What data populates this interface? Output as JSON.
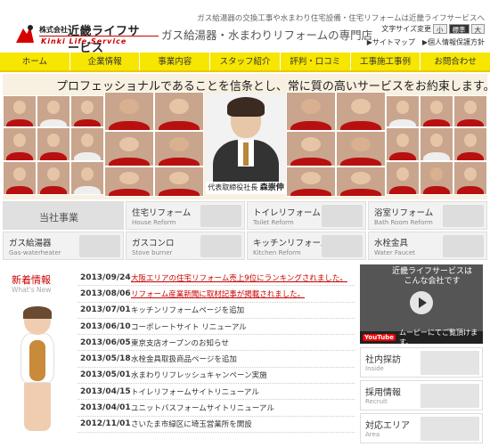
{
  "header": {
    "logo_corp": "株式会社",
    "logo_name": "近畿ライフサービス",
    "logo_en": "Kinki Life Service",
    "tagline": "ガス給湯器・水まわりリフォームの専門店",
    "top_note": "ガス給湯器の交換工事や水まわり住宅設備・住宅リフォームは近畿ライフサービスへ",
    "font_size_label": "文字サイズ変更",
    "font_sizes": [
      "小",
      "標準",
      "大"
    ],
    "sitemap": "サイトマップ",
    "privacy": "個人情報保護方針",
    "arrow": "▶"
  },
  "nav": {
    "items": [
      "ホーム",
      "企業情報",
      "事業内容",
      "スタッフ紹介",
      "評判・口コミ",
      "工事施工事例",
      "お問合わせ"
    ]
  },
  "hero": {
    "headline": "プロフェッショナルであることを信条とし、常に質の高いサービスをお約束します。",
    "ceo_title": "代表取締役社長",
    "ceo_name": "森崇伸"
  },
  "services": {
    "main": "当社事業",
    "items": [
      {
        "title": "住宅リフォーム",
        "en": "House Reform"
      },
      {
        "title": "トイレリフォーム",
        "en": "Toilet Reform"
      },
      {
        "title": "浴室リフォーム",
        "en": "Bath Room Reform"
      },
      {
        "title": "ガス給湯器",
        "en": "Gas-waterheater"
      },
      {
        "title": "ガスコンロ",
        "en": "Stove burner"
      },
      {
        "title": "キッチンリフォーム",
        "en": "Kitchen Reform"
      },
      {
        "title": "水栓金具",
        "en": "Water Faucet"
      }
    ]
  },
  "news": {
    "title_jp": "新着情報",
    "title_en": "What's New",
    "items": [
      {
        "date": "2013/09/24",
        "text": "大阪エリアの住宅リフォーム売上9位にランキングされました。",
        "link": true
      },
      {
        "date": "2013/08/06",
        "text": "リフォーム産業新聞に取材記事が掲載されました。",
        "link": true
      },
      {
        "date": "2013/07/01",
        "text": "キッチンリフォームページを追加",
        "link": false
      },
      {
        "date": "2013/06/10",
        "text": "コーポレートサイト リニューアル",
        "link": false
      },
      {
        "date": "2013/06/05",
        "text": "東京支店オープンのお知らせ",
        "link": false
      },
      {
        "date": "2013/05/18",
        "text": "水栓金具取扱商品ページを追加",
        "link": false
      },
      {
        "date": "2013/05/01",
        "text": "水まわりリフレッシュキャンペーン実施",
        "link": false
      },
      {
        "date": "2013/04/15",
        "text": "トイレリフォームサイトリニューアル",
        "link": false
      },
      {
        "date": "2013/04/01",
        "text": "ユニットバスフォームサイトリニューアル",
        "link": false
      },
      {
        "date": "2012/11/01",
        "text": "さいたま市緑区に埼玉営業所を開設",
        "link": false
      }
    ]
  },
  "video": {
    "title_line1": "近畿ライフサービスは",
    "title_line2": "こんな会社です",
    "yt": "YouTube",
    "caption": "ムービーにてご覧頂けます。"
  },
  "sidebar": {
    "items": [
      {
        "title": "社内探訪",
        "en": "Inside"
      },
      {
        "title": "採用情報",
        "en": "Recruit"
      },
      {
        "title": "対応エリア",
        "en": "Area"
      }
    ]
  },
  "colors": {
    "nav_bg": "#f6e600",
    "accent_red": "#d60000"
  }
}
